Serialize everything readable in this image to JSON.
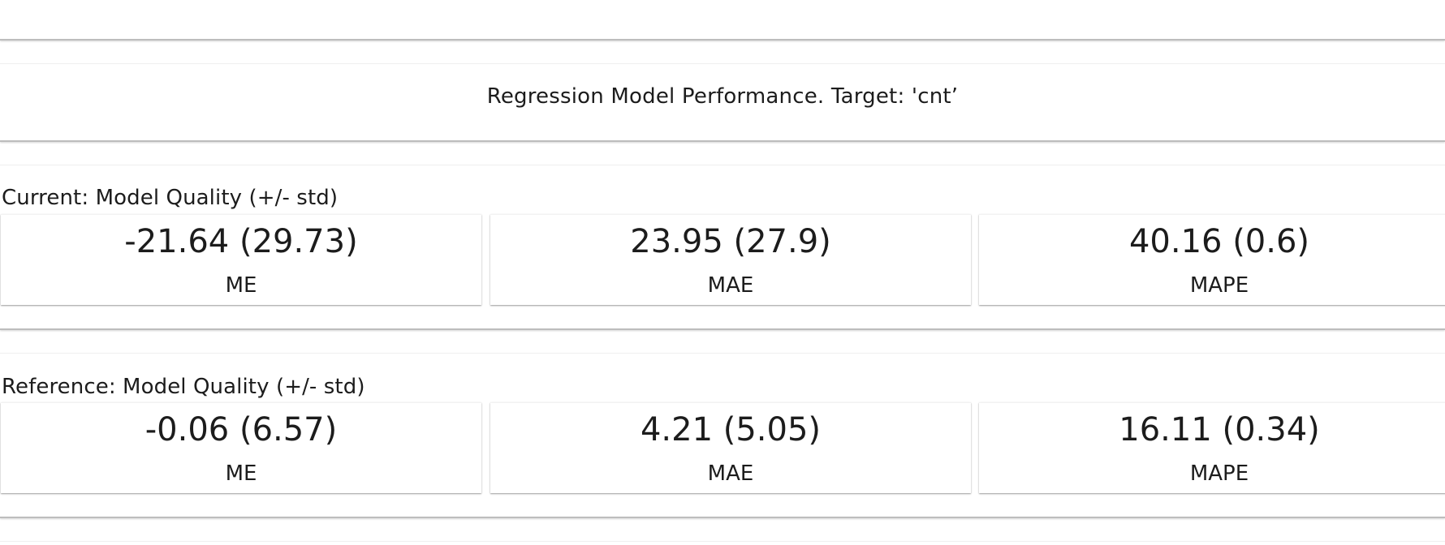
{
  "report": {
    "title": "Regression Model Performance. Target: 'cnt’"
  },
  "current": {
    "title": "Current: Model Quality (+/- std)",
    "metrics": [
      {
        "value": "-21.64 (29.73)",
        "label": "ME"
      },
      {
        "value": "23.95 (27.9)",
        "label": "MAE"
      },
      {
        "value": "40.16 (0.6)",
        "label": "MAPE"
      }
    ]
  },
  "reference": {
    "title": "Reference: Model Quality (+/- std)",
    "metrics": [
      {
        "value": "-0.06 (6.57)",
        "label": "ME"
      },
      {
        "value": "4.21 (5.05)",
        "label": "MAE"
      },
      {
        "value": "16.11 (0.34)",
        "label": "MAPE"
      }
    ]
  }
}
